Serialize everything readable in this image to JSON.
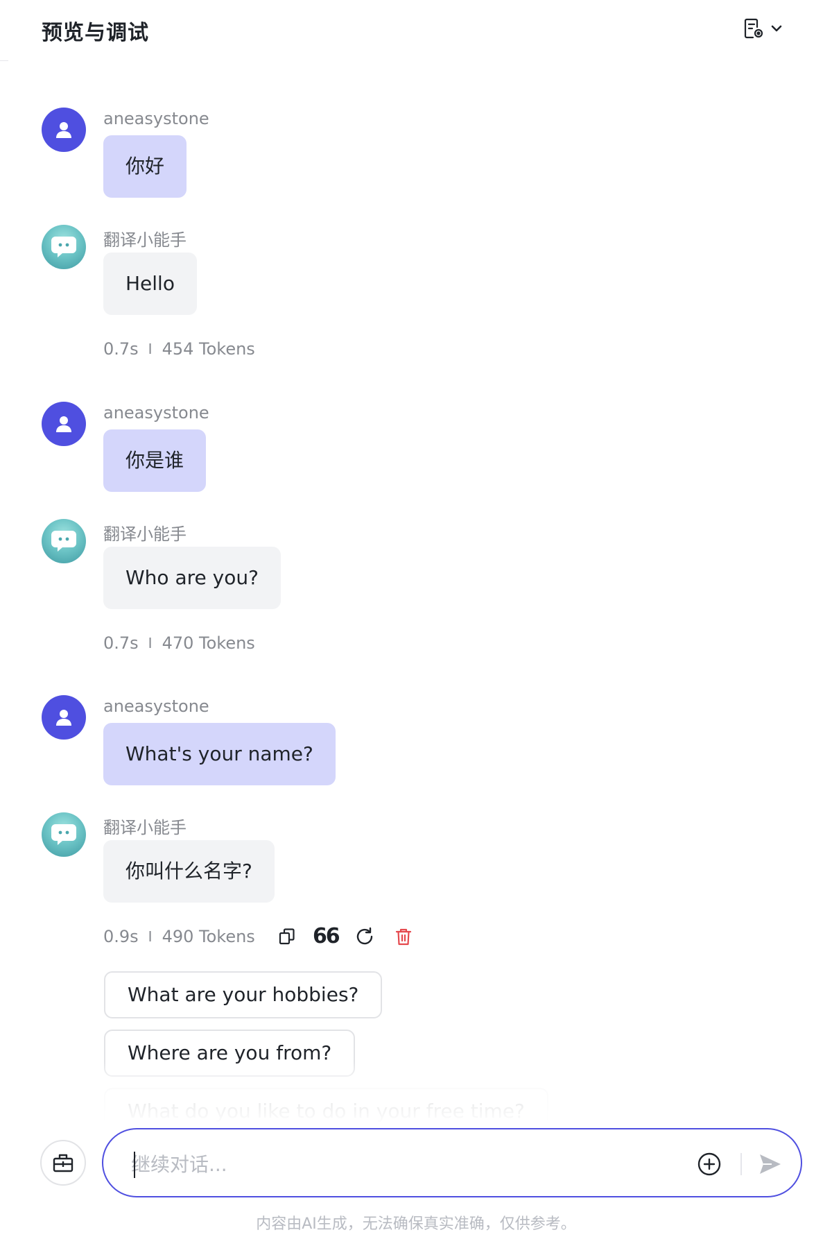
{
  "header": {
    "title": "预览与调试",
    "menu_icon": "document-settings-icon",
    "chevron_icon": "chevron-down-icon"
  },
  "conversation": [
    {
      "role": "user",
      "sender": "aneasystone",
      "text": "你好"
    },
    {
      "role": "bot",
      "sender": "翻译小能手",
      "text": "Hello",
      "time": "0.7s",
      "separator": "I",
      "tokens": "454 Tokens"
    },
    {
      "role": "user",
      "sender": "aneasystone",
      "text": "你是谁"
    },
    {
      "role": "bot",
      "sender": "翻译小能手",
      "text": "Who are you?",
      "time": "0.7s",
      "separator": "I",
      "tokens": "470 Tokens"
    },
    {
      "role": "user",
      "sender": "aneasystone",
      "text": "What's your name?"
    },
    {
      "role": "bot",
      "sender": "翻译小能手",
      "text": "你叫什么名字?",
      "time": "0.9s",
      "separator": "I",
      "tokens": "490 Tokens"
    }
  ],
  "message_actions": {
    "copy_icon": "copy-icon",
    "quote_icon": "quote-icon",
    "quote_glyph": "66",
    "regenerate_icon": "refresh-icon",
    "delete_icon": "trash-icon"
  },
  "suggestions": [
    "What are your hobbies?",
    "Where are you from?",
    "What do you like to do in your free time?"
  ],
  "composer": {
    "placeholder": "继续对话...",
    "value": "",
    "tool_icon": "toolbox-icon",
    "plus_icon": "plus-circle-icon",
    "send_icon": "send-icon"
  },
  "footer": {
    "disclaimer": "内容由AI生成，无法确保真实准确，仅供参考。"
  },
  "colors": {
    "accent": "#4f4fe0",
    "user_bubble": "#d4d6fb",
    "bot_bubble": "#f2f3f5",
    "muted_text": "#86898f",
    "delete_red": "#e5484d"
  }
}
